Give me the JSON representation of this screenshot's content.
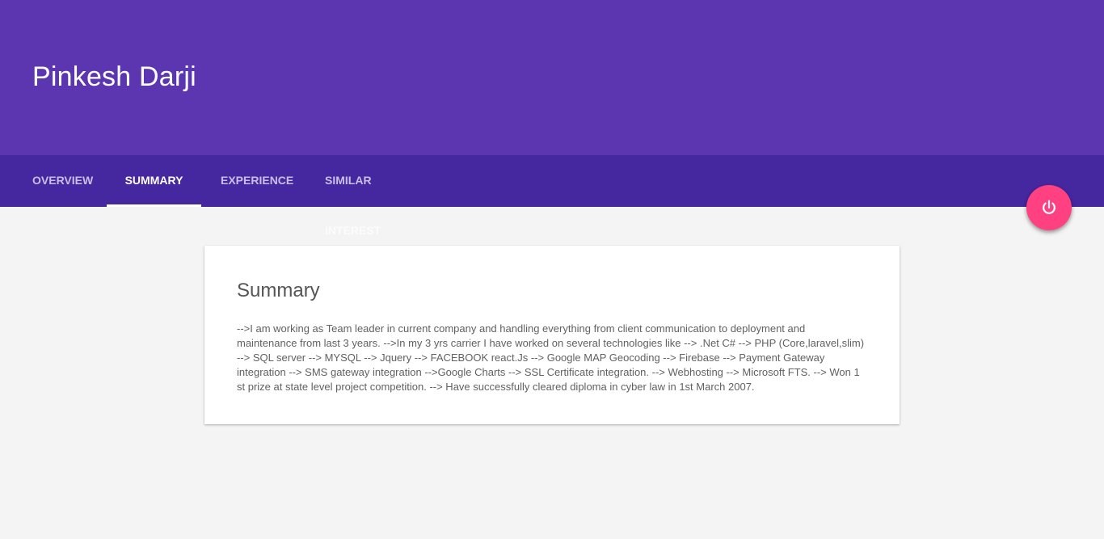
{
  "header": {
    "title": "Pinkesh Darji"
  },
  "tabs": [
    {
      "label": "OVERVIEW",
      "active": false
    },
    {
      "label": "SUMMARY",
      "active": true
    },
    {
      "label": "EXPERIENCE",
      "active": false
    },
    {
      "label": "SIMILAR INTEREST",
      "active": false
    }
  ],
  "fab": {
    "icon": "power-icon",
    "color": "#ff4081"
  },
  "summary": {
    "title": "Summary",
    "body": "-->I am working as Team leader in current company and handling everything from client communication to deployment and maintenance from last 3 years. -->In my 3 yrs carrier I have worked on several technologies like --> .Net C# --> PHP (Core,laravel,slim) --> SQL server --> MYSQL --> Jquery --> FACEBOOK react.Js --> Google MAP Geocoding --> Firebase --> Payment Gateway integration --> SMS gateway integration -->Google Charts --> SSL Certificate integration. --> Webhosting --> Microsoft FTS. --> Won 1 st prize at state level project competition. --> Have successfully cleared diploma in cyber law in 1st March 2007."
  },
  "colors": {
    "header": "#5c35b1",
    "tabbar": "#4527a0",
    "accent": "#ff4081",
    "background": "#f4f4f4"
  }
}
